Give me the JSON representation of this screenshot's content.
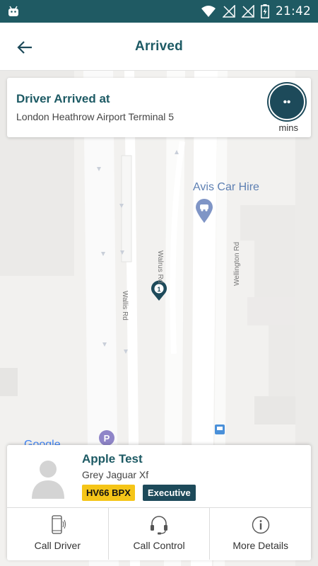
{
  "status_bar": {
    "time": "21:42",
    "icons": [
      "android-icon",
      "wifi-icon",
      "no-sim-icon",
      "no-sim-icon",
      "battery-charging-icon"
    ]
  },
  "app_bar": {
    "title": "Arrived",
    "back_icon": "arrow-left-icon"
  },
  "arrival": {
    "heading": "Driver Arrived at",
    "location": "London Heathrow Airport Terminal 5",
    "eta_value": "••",
    "eta_unit": "mins"
  },
  "map": {
    "poi_label": "Avis Car Hire",
    "roads": [
      "Walrus Rd",
      "Wallis Rd",
      "Wellington Rd"
    ],
    "pin_number": "1",
    "watermark": "Google",
    "parking_label": "P"
  },
  "driver": {
    "name": "Apple Test",
    "car": "Grey Jaguar Xf",
    "plate": "HV66 BPX",
    "class": "Executive"
  },
  "actions": [
    {
      "label": "Call Driver",
      "icon": "phone-icon"
    },
    {
      "label": "Call Control",
      "icon": "headset-icon"
    },
    {
      "label": "More Details",
      "icon": "info-icon"
    }
  ],
  "colors": {
    "status_bar": "#1f5a63",
    "accent": "#1d5a64",
    "dark_badge": "#1d4a5a",
    "plate_yellow": "#f5c518"
  }
}
